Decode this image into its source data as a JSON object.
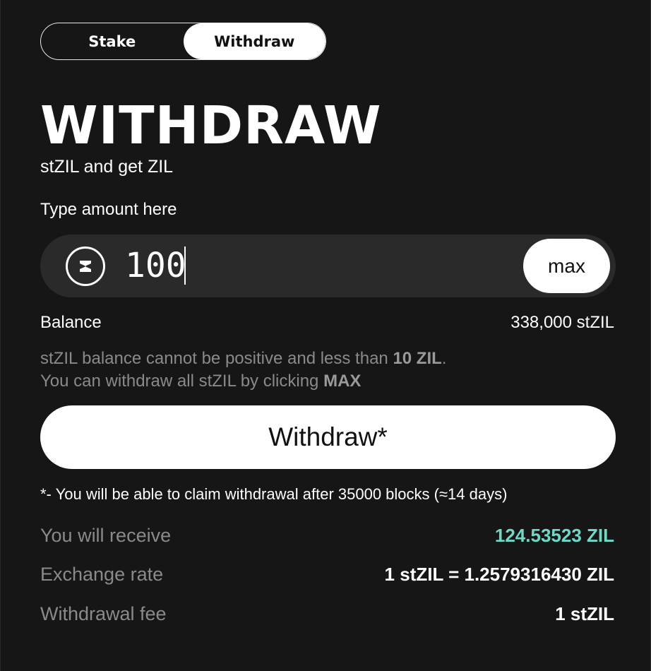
{
  "tabs": [
    {
      "label": "Stake",
      "active": false
    },
    {
      "label": "Withdraw",
      "active": true
    }
  ],
  "header": {
    "title": "WITHDRAW",
    "subtitle": "stZIL and get ZIL"
  },
  "amount": {
    "label": "Type amount here",
    "value": "100",
    "token_icon": "zilliqa-logo-icon",
    "max_label": "max"
  },
  "balance": {
    "label": "Balance",
    "value": "338,000 stZIL"
  },
  "warning": {
    "line1_prefix": "stZIL balance cannot be positive and less than ",
    "line1_bold": "10 ZIL",
    "line1_suffix": ".",
    "line2_prefix": "You can withdraw all stZIL by clicking ",
    "line2_bold": "MAX"
  },
  "action": {
    "withdraw_label": "Withdraw*",
    "footnote": "*- You will be able to claim withdrawal after 35000 blocks (≈14 days)"
  },
  "summary": {
    "receive_label": "You will receive",
    "receive_value": "124.53523 ZIL",
    "rate_label": "Exchange rate",
    "rate_value": "1 stZIL = 1.2579316430 ZIL",
    "fee_label": "Withdrawal fee",
    "fee_value": "1 stZIL"
  },
  "colors": {
    "background": "#161616",
    "input_bg": "#2a2a2a",
    "accent_teal": "#6fd9c6",
    "muted_text": "#8a8a8a"
  }
}
